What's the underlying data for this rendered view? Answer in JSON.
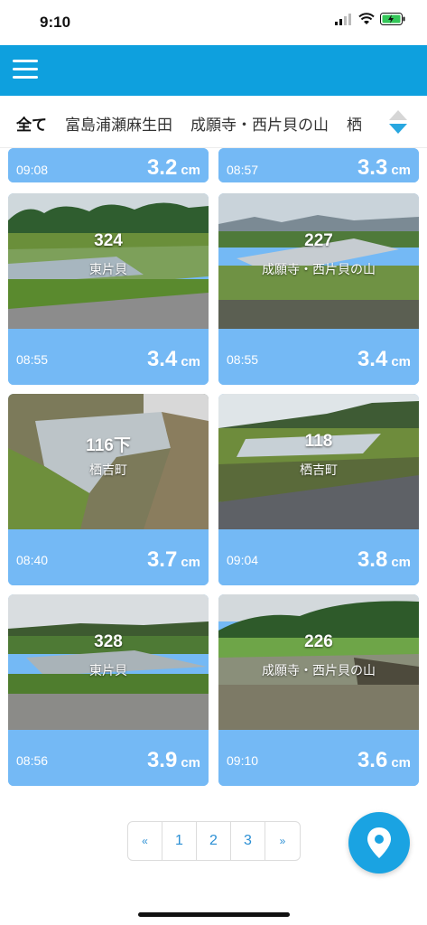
{
  "status_bar": {
    "time": "9:10"
  },
  "tabs": {
    "items": [
      {
        "label": "全て",
        "active": true
      },
      {
        "label": "富島浦瀬麻生田",
        "active": false
      },
      {
        "label": "成願寺・西片貝の山",
        "active": false
      },
      {
        "label": "栖",
        "active": false
      }
    ]
  },
  "partial_cards": [
    {
      "time": "09:08",
      "level": "3.2",
      "unit": "cm"
    },
    {
      "time": "08:57",
      "level": "3.3",
      "unit": "cm"
    }
  ],
  "cards": [
    {
      "id": "324",
      "name": "東片貝",
      "time": "08:55",
      "level": "3.4",
      "unit": "cm"
    },
    {
      "id": "227",
      "name": "成願寺・西片貝の山",
      "time": "08:55",
      "level": "3.4",
      "unit": "cm"
    },
    {
      "id": "116下",
      "name": "栖吉町",
      "time": "08:40",
      "level": "3.7",
      "unit": "cm"
    },
    {
      "id": "118",
      "name": "栖吉町",
      "time": "09:04",
      "level": "3.8",
      "unit": "cm"
    },
    {
      "id": "328",
      "name": "東片貝",
      "time": "08:56",
      "level": "3.9",
      "unit": "cm"
    },
    {
      "id": "226",
      "name": "成願寺・西片貝の山",
      "time": "09:10",
      "level": "3.6",
      "unit": "cm"
    }
  ],
  "pagination": {
    "prev": "«",
    "pages": [
      "1",
      "2",
      "3"
    ],
    "next": "»"
  },
  "icons": {
    "menu": "hamburger-menu-icon",
    "sort": "sort-arrows-icon",
    "fab": "map-pin-icon"
  },
  "colors": {
    "header": "#0ea0de",
    "card_info": "#74b9f5",
    "accent": "#1aa3e2"
  }
}
